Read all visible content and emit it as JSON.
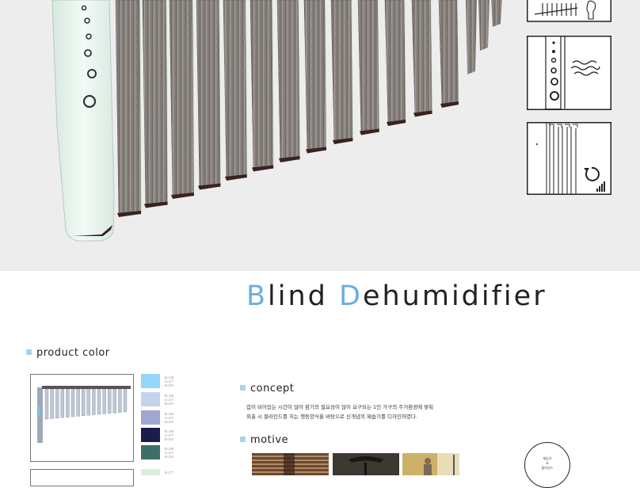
{
  "title": {
    "first_letter": "B",
    "part1": "lind ",
    "second_letter": "D",
    "part2": "ehumidifier"
  },
  "sections": {
    "product_color": "product color",
    "concept": "concept",
    "motive": "motive"
  },
  "swatches": [
    {
      "color": "#94d7f8",
      "code": "R:148\nG:217\nB:255"
    },
    {
      "color": "#c4d3ef",
      "code": "R:148\nG:217\nB:255"
    },
    {
      "color": "#9fa6d2",
      "code": "R:148\nG:217\nB:255"
    },
    {
      "color": "#1b1b4d",
      "code": "R:148\nG:217\nB:255"
    },
    {
      "color": "#3c6f68",
      "code": "R:148\nG:217\nB:255"
    },
    {
      "color": "#d8eedc",
      "code": "R:177"
    }
  ],
  "concept_text": {
    "line1": "집이 비어있는 시간이 많아  환기의 필요성이 많이 요구되는 1인 가구의 주거환경에 맞춰",
    "line2": "외출 시 블라인드를 치는 행동양식을 바탕으로 신개념의 제습기를 디자인하였다."
  },
  "circle_label": "제습기\n&\n블라인드",
  "colors": {
    "accent": "#6aaee0",
    "hero_bg": "#ededed",
    "frame_mint": "#e8f4ef",
    "slat": "#8a8480",
    "slat_edge": "#3a2220"
  },
  "icons": [
    "blind-open-icon",
    "dehumidify-airflow-icon",
    "blind-rotate-icon"
  ]
}
